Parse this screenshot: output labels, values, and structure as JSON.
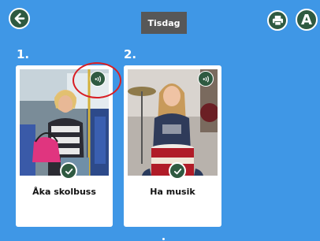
{
  "header": {
    "back_icon": "arrow-left-icon",
    "title": "Tisdag",
    "print_icon": "printer-icon",
    "letter_button": "A"
  },
  "activities": [
    {
      "number": "1.",
      "label": "Åka skolbuss",
      "audio_icon": "speaker-icon",
      "status_icon": "checkmark-icon",
      "done": true
    },
    {
      "number": "2.",
      "label": "Ha musik",
      "audio_icon": "speaker-icon",
      "status_icon": "checkmark-icon",
      "done": true
    }
  ],
  "colors": {
    "background": "#3f97e6",
    "button": "#2f5a41",
    "title_bg": "#575757",
    "highlight": "#d81e24"
  }
}
